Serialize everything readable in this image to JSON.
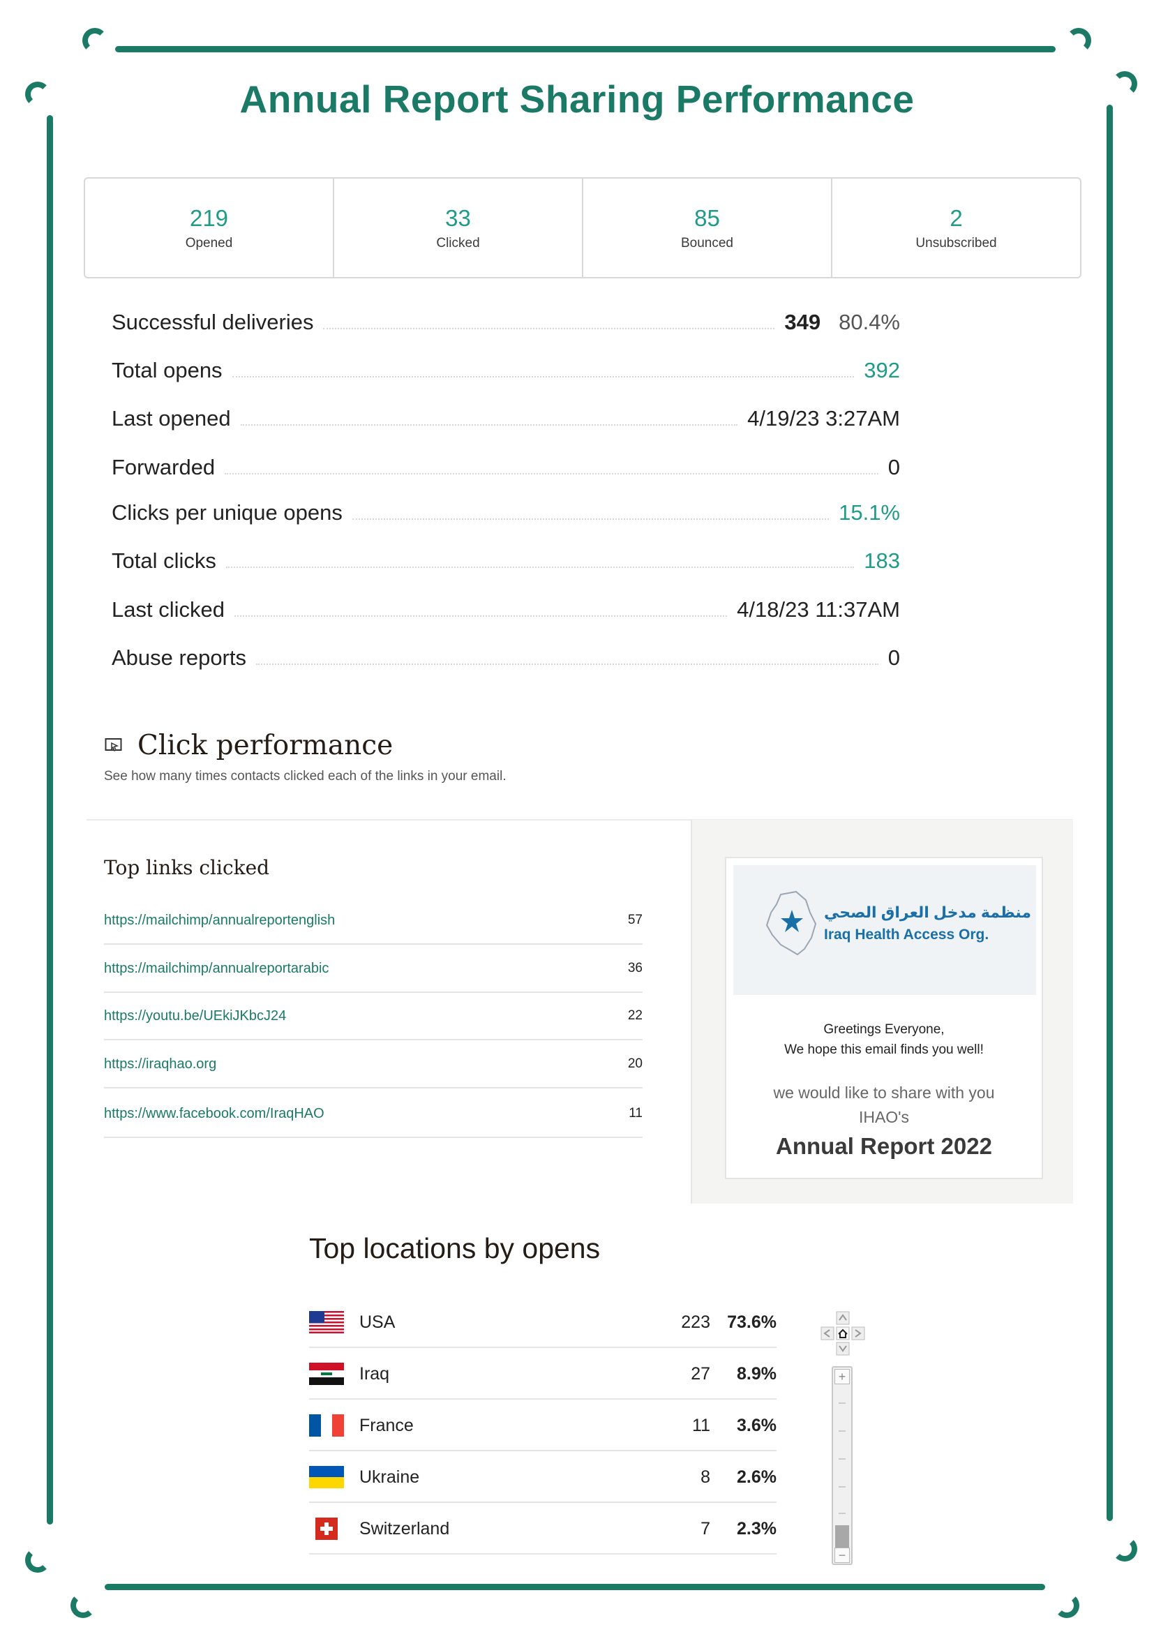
{
  "title": "Annual Report Sharing Performance",
  "stats": [
    {
      "value": "219",
      "label": "Opened"
    },
    {
      "value": "33",
      "label": "Clicked"
    },
    {
      "value": "85",
      "label": "Bounced"
    },
    {
      "value": "2",
      "label": "Unsubscribed"
    }
  ],
  "details": {
    "successful_deliveries": {
      "label": "Successful deliveries",
      "count": "349",
      "percent": "80.4%"
    },
    "total_opens": {
      "label": "Total opens",
      "value": "392"
    },
    "last_opened": {
      "label": "Last opened",
      "value": "4/19/23 3:27AM"
    },
    "forwarded": {
      "label": "Forwarded",
      "value": "0"
    },
    "clicks_per_unique_opens": {
      "label": "Clicks per unique opens",
      "value": "15.1%"
    },
    "total_clicks": {
      "label": "Total clicks",
      "value": "183"
    },
    "last_clicked": {
      "label": "Last clicked",
      "value": "4/18/23 11:37AM"
    },
    "abuse_reports": {
      "label": "Abuse reports",
      "value": "0"
    }
  },
  "click_performance": {
    "title": "Click performance",
    "subtitle": "See how many times contacts clicked each of the links in your email."
  },
  "top_links": {
    "title": "Top links clicked",
    "links": [
      {
        "url": "https://mailchimp/annualreportenglish",
        "count": "57"
      },
      {
        "url": "https://mailchimp/annualreportarabic",
        "count": "36"
      },
      {
        "url": "https://youtu.be/UEkiJKbcJ24",
        "count": "22"
      },
      {
        "url": "https://iraqhao.org",
        "count": "20"
      },
      {
        "url": "https://www.facebook.com/IraqHAO",
        "count": "11"
      }
    ]
  },
  "email_preview": {
    "logo_arabic": "منظمة مدخل العراق الصحي",
    "logo_english": "Iraq Health Access Org.",
    "greeting_line1": "Greetings Everyone,",
    "greeting_line2": "We hope this email finds you well!",
    "share_line": "we would like to share with you",
    "org_line": "IHAO's",
    "report_title": "Annual Report 2022"
  },
  "locations": {
    "title": "Top locations by opens",
    "rows": [
      {
        "country": "USA",
        "count": "223",
        "percent": "73.6%",
        "flag": "usa-flag"
      },
      {
        "country": "Iraq",
        "count": "27",
        "percent": "8.9%",
        "flag": "iraq-flag"
      },
      {
        "country": "France",
        "count": "11",
        "percent": "3.6%",
        "flag": "france-flag"
      },
      {
        "country": "Ukraine",
        "count": "8",
        "percent": "2.6%",
        "flag": "ukraine-flag"
      },
      {
        "country": "Switzerland",
        "count": "7",
        "percent": "2.3%",
        "flag": "switzerland-flag"
      }
    ]
  },
  "colors": {
    "brand_teal": "#1a7a66",
    "accent_teal": "#1f9b87",
    "link_teal": "#1a7a66"
  }
}
